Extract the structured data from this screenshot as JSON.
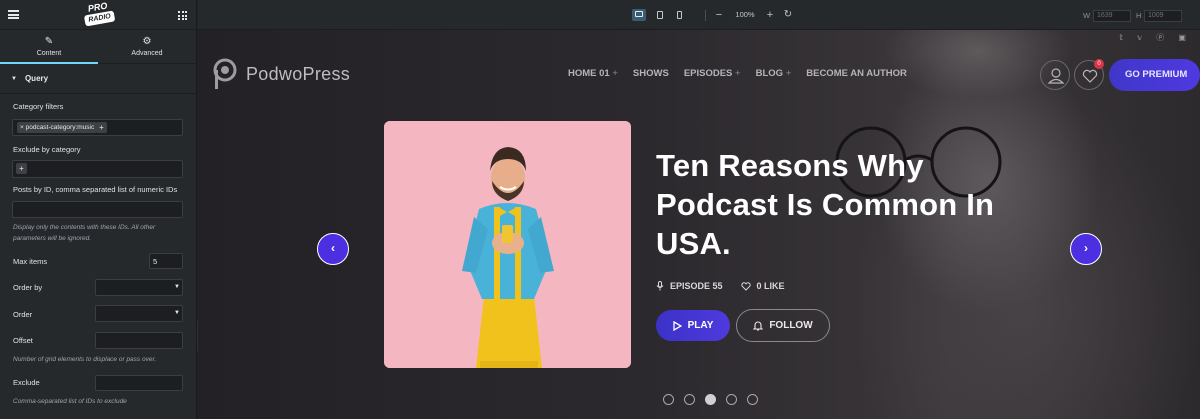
{
  "editor": {
    "logo": {
      "line1": "PRO",
      "line2": "RADIO"
    },
    "tabs": [
      {
        "label": "Content",
        "icon": "pencil-icon",
        "active": true
      },
      {
        "label": "Advanced",
        "icon": "gear-icon",
        "active": false
      }
    ],
    "section": {
      "title": "Query"
    },
    "fields": {
      "category_filters": {
        "label": "Category filters",
        "tag": "× podcast-category:music"
      },
      "exclude_by_category": {
        "label": "Exclude by category"
      },
      "posts_by_id": {
        "label": "Posts by ID, comma separated list of numeric IDs",
        "note": "Display only the contents with these IDs. All other parameters will be ignored."
      },
      "max_items": {
        "label": "Max items",
        "value": "5"
      },
      "order_by": {
        "label": "Order by"
      },
      "order": {
        "label": "Order"
      },
      "offset": {
        "label": "Offset",
        "note": "Number of grid elements to displace or pass over."
      },
      "exclude": {
        "label": "Exclude",
        "note": "Comma-separated list of IDs to exclude"
      }
    }
  },
  "toolbar": {
    "zoom": "100%",
    "width_label": "W",
    "width_value": "1639",
    "height_label": "H",
    "height_value": "1009"
  },
  "site": {
    "brand": "PodwoPress",
    "nav": [
      {
        "label": "HOME 01",
        "has_plus": true
      },
      {
        "label": "SHOWS",
        "has_plus": false
      },
      {
        "label": "EPISODES",
        "has_plus": true
      },
      {
        "label": "BLOG",
        "has_plus": true
      },
      {
        "label": "BECOME AN AUTHOR",
        "has_plus": false
      }
    ],
    "wishlist_count": "0",
    "cta": "GO PREMIUM",
    "hero": {
      "title": "Ten Reasons Why Podcast Is Common In USA.",
      "episode": "EPISODE 55",
      "likes": "0 LIKE",
      "play_label": "PLAY",
      "follow_label": "FOLLOW"
    },
    "slider_dots": 5,
    "active_dot": 3
  },
  "colors": {
    "accent": "#4b2fe0",
    "editor_bg": "#26292c",
    "editor_active_tab": "#71d7f7",
    "cover_bg": "#f3b6c1"
  }
}
